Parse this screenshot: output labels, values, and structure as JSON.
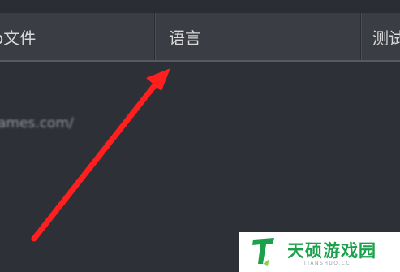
{
  "tabs": {
    "file": "o文件",
    "language": "语言",
    "test": "测试"
  },
  "content": {
    "url": "ames.com/"
  },
  "watermark": {
    "name": "天硕游戏园",
    "subtitle": "TIANSHUO.CC"
  },
  "annotation": {
    "arrow_color": "#ff1f1f"
  }
}
